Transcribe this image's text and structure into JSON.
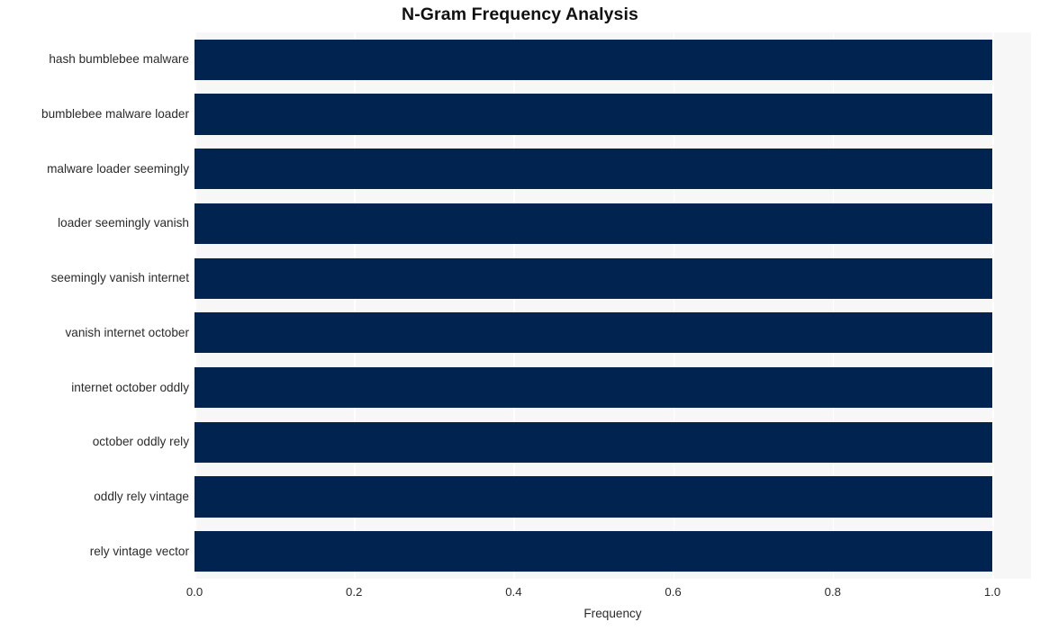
{
  "chart_data": {
    "type": "bar",
    "orientation": "horizontal",
    "title": "N-Gram Frequency Analysis",
    "xlabel": "Frequency",
    "ylabel": "",
    "categories": [
      "hash bumblebee malware",
      "bumblebee malware loader",
      "malware loader seemingly",
      "loader seemingly vanish",
      "seemingly vanish internet",
      "vanish internet october",
      "internet october oddly",
      "october oddly rely",
      "oddly rely vintage",
      "rely vintage vector"
    ],
    "values": [
      1.0,
      1.0,
      1.0,
      1.0,
      1.0,
      1.0,
      1.0,
      1.0,
      1.0,
      1.0
    ],
    "xlim": [
      0.0,
      1.0
    ],
    "xticks": [
      0.0,
      0.2,
      0.4,
      0.6,
      0.8,
      1.0
    ],
    "xtick_labels": [
      "0.0",
      "0.2",
      "0.4",
      "0.6",
      "0.8",
      "1.0"
    ],
    "grid": true,
    "grid_axis": "x",
    "legend": false,
    "bar_color": "#01234f",
    "plot_background": "#f7f7f7",
    "gridline_color": "#ffffff",
    "figure_background": "#ffffff",
    "text_color": "#2b2b2b"
  }
}
